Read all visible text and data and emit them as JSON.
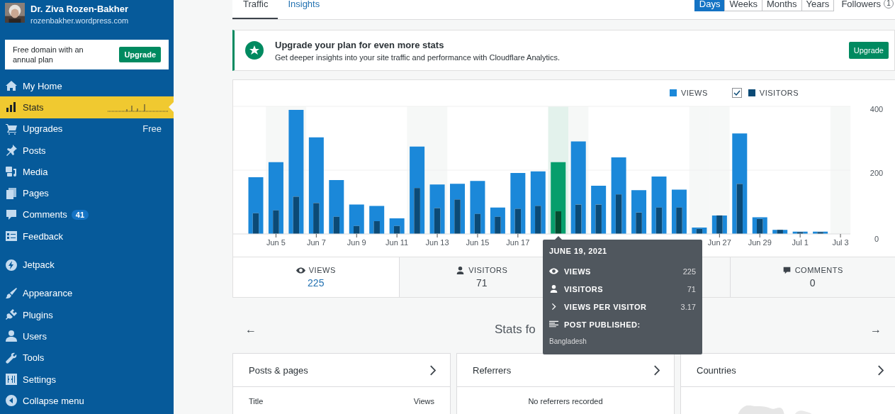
{
  "profile": {
    "name": "Dr. Ziva Rozen-Bakher",
    "url": "rozenbakher.wordpress.com"
  },
  "promo": {
    "text": "Free domain with an annual plan",
    "button": "Upgrade"
  },
  "sidebar": {
    "groups": [
      {
        "items": [
          {
            "label": "My Home",
            "selected": false
          },
          {
            "label": "Stats",
            "selected": true
          },
          {
            "label": "Upgrades",
            "selected": false,
            "note": "Free"
          },
          {
            "label": "Posts",
            "selected": false
          },
          {
            "label": "Media",
            "selected": false
          },
          {
            "label": "Pages",
            "selected": false
          },
          {
            "label": "Comments",
            "selected": false,
            "badge": "41"
          },
          {
            "label": "Feedback",
            "selected": false
          }
        ]
      },
      {
        "items": [
          {
            "label": "Jetpack",
            "selected": false
          }
        ]
      },
      {
        "items": [
          {
            "label": "Appearance",
            "selected": false
          },
          {
            "label": "Plugins",
            "selected": false
          },
          {
            "label": "Users",
            "selected": false
          },
          {
            "label": "Tools",
            "selected": false
          },
          {
            "label": "Settings",
            "selected": false
          },
          {
            "label": "Collapse menu",
            "selected": false
          }
        ]
      }
    ]
  },
  "tabs": [
    {
      "label": "Traffic",
      "selected": true
    },
    {
      "label": "Insights",
      "selected": false
    }
  ],
  "periods": [
    {
      "label": "Days",
      "selected": true
    },
    {
      "label": "Weeks",
      "selected": false
    },
    {
      "label": "Months",
      "selected": false
    },
    {
      "label": "Years",
      "selected": false
    }
  ],
  "followers": {
    "label": "Followers",
    "count": "1"
  },
  "banner": {
    "title": "Upgrade your plan for even more stats",
    "text": "Get deeper insights into your site traffic and performance with Cloudflare Analytics.",
    "button": "Upgrade"
  },
  "chart": {
    "legend": [
      {
        "label": "VIEWS",
        "color": "#1b88d9",
        "kind": "plain"
      },
      {
        "label": "VISITORS",
        "color": "#0b4a76",
        "kind": "toggle",
        "checked": true
      }
    ],
    "chart_data": {
      "type": "bar",
      "categories": [
        null,
        "Jun 5",
        null,
        "Jun 7",
        null,
        "Jun 9",
        null,
        "Jun 11",
        null,
        "Jun 13",
        null,
        "Jun 15",
        null,
        "Jun 17",
        null,
        null,
        null,
        null,
        null,
        null,
        null,
        null,
        null,
        "Jun 27",
        null,
        "Jun 29",
        null,
        "Jul 1",
        null,
        "Jul 3"
      ],
      "series": [
        {
          "color": "#1b88d9",
          "values": [
            178,
            225,
            389,
            303,
            169,
            92,
            88,
            49,
            274,
            155,
            157,
            166,
            83,
            191,
            196,
            null,
            290,
            151,
            240,
            137,
            180,
            139,
            20,
            58,
            315,
            52,
            13,
            7,
            7,
            null
          ]
        },
        {
          "color": "#0b4a76",
          "values": [
            65,
            74,
            117,
            97,
            54,
            25,
            40,
            25,
            144,
            81,
            108,
            63,
            54,
            79,
            88,
            null,
            92,
            92,
            124,
            67,
            83,
            83,
            16,
            58,
            157,
            47,
            13,
            6,
            6,
            null
          ]
        },
        {
          "color": "#069e6c",
          "values": [
            null,
            null,
            null,
            null,
            null,
            null,
            null,
            null,
            null,
            null,
            null,
            null,
            null,
            null,
            null,
            225,
            null,
            null,
            null,
            null,
            null,
            null,
            null,
            null,
            null,
            null,
            null,
            null,
            null,
            null
          ]
        },
        {
          "color": "#044d30",
          "values": [
            null,
            null,
            null,
            null,
            null,
            null,
            null,
            null,
            null,
            null,
            null,
            null,
            null,
            null,
            null,
            71,
            null,
            null,
            null,
            null,
            null,
            null,
            null,
            null,
            null,
            null,
            null,
            null,
            null,
            null
          ]
        }
      ],
      "ylim": [
        0,
        400
      ],
      "yticks": [
        0,
        200,
        400
      ]
    }
  },
  "stat_tabs": [
    {
      "label": "VIEWS",
      "value": "225",
      "selected": true
    },
    {
      "label": "VISITORS",
      "value": "71",
      "selected": false
    },
    {
      "label": "COMMENTS",
      "value": "0",
      "selected": false
    }
  ],
  "tooltip": {
    "date": "JUNE 19, 2021",
    "rows": [
      {
        "kind": "views",
        "label": "VIEWS",
        "value": "225"
      },
      {
        "kind": "visitors",
        "label": "VISITORS",
        "value": "71"
      },
      {
        "kind": "ratio",
        "label": "VIEWS PER VISITOR",
        "value": "3.17"
      },
      {
        "kind": "post",
        "label": "POST PUBLISHED:"
      }
    ],
    "post": "Bangladesh"
  },
  "period_nav": {
    "prev": "←",
    "title": "Stats fo",
    "next": "→"
  },
  "cards": [
    {
      "title": "Posts & pages",
      "kind": "table",
      "columns": [
        "Title",
        "Views"
      ]
    },
    {
      "title": "Referrers",
      "kind": "empty",
      "message": "No referrers recorded"
    },
    {
      "title": "Countries",
      "kind": "map"
    }
  ]
}
